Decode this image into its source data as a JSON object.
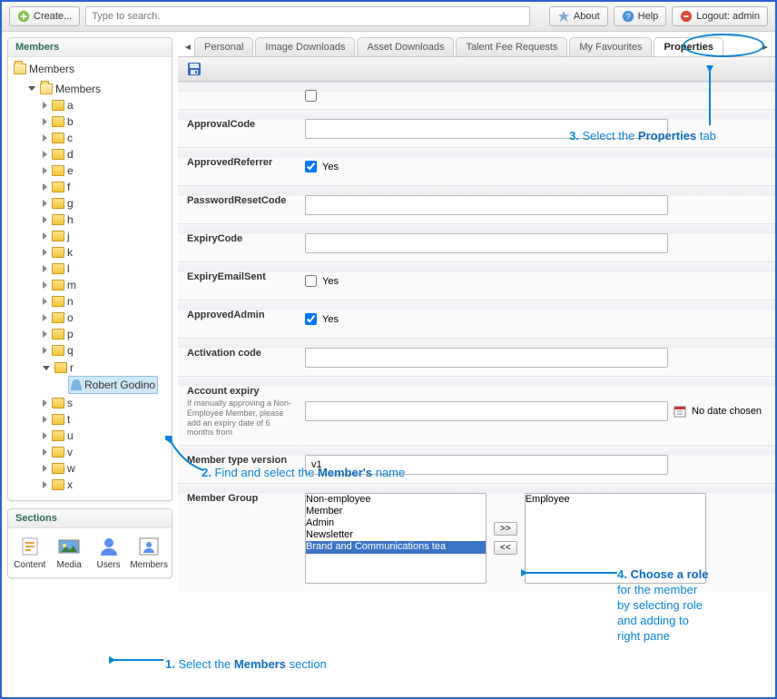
{
  "topbar": {
    "create_label": "Create...",
    "search_placeholder": "Type to search.",
    "about_label": "About",
    "help_label": "Help",
    "logout_label": "Logout: admin"
  },
  "left_panel": {
    "title": "Members",
    "root": "Members",
    "group": "Members",
    "letters": [
      "a",
      "b",
      "c",
      "d",
      "e",
      "f",
      "g",
      "h",
      "j",
      "k",
      "l",
      "m",
      "n",
      "o",
      "p",
      "q",
      "r",
      "s",
      "t",
      "u",
      "v",
      "w",
      "x"
    ],
    "expanded_letter": "r",
    "selected_member": "Robert Godino"
  },
  "sections": {
    "title": "Sections",
    "items": [
      {
        "label": "Content"
      },
      {
        "label": "Media"
      },
      {
        "label": "Users"
      },
      {
        "label": "Members"
      }
    ]
  },
  "tabs": {
    "items": [
      {
        "label": "Personal"
      },
      {
        "label": "Image Downloads"
      },
      {
        "label": "Asset Downloads"
      },
      {
        "label": "Talent Fee Requests"
      },
      {
        "label": "My Favourites"
      },
      {
        "label": "Properties",
        "active": true
      }
    ]
  },
  "form": {
    "approval_code": {
      "label": "ApprovalCode",
      "value": ""
    },
    "approved_referrer": {
      "label": "ApprovedReferrer",
      "checked": true,
      "yes": "Yes"
    },
    "password_reset_code": {
      "label": "PasswordResetCode",
      "value": ""
    },
    "expiry_code": {
      "label": "ExpiryCode",
      "value": ""
    },
    "expiry_email_sent": {
      "label": "ExpiryEmailSent",
      "checked": false,
      "yes": "Yes"
    },
    "approved_admin": {
      "label": "ApprovedAdmin",
      "checked": true,
      "yes": "Yes"
    },
    "activation_code": {
      "label": "Activation code",
      "value": ""
    },
    "account_expiry": {
      "label": "Account expiry",
      "hint": "If manually approving a Non-Employee Member, please add an expiry date of 6 months from",
      "value": "",
      "no_date": "No date chosen"
    },
    "member_type_version": {
      "label": "Member type version",
      "value": "v1"
    },
    "member_group": {
      "label": "Member Group",
      "available": [
        "Non-employee",
        "Member",
        "Admin",
        "Newsletter",
        "Brand and Communications tea"
      ],
      "available_selected": "Brand and Communications tea",
      "chosen": [
        "Employee"
      ],
      "add": ">>",
      "remove": "<<"
    }
  },
  "annotations": {
    "a1": {
      "num": "1.",
      "text": "Select the ",
      "bold": "Members",
      "suffix": " section"
    },
    "a2": {
      "num": "2.",
      "text": "Find and select the ",
      "bold": "Member's",
      "suffix": " name"
    },
    "a3": {
      "num": "3.",
      "text": "Select the ",
      "bold": "Properties",
      "suffix": " tab"
    },
    "a4": {
      "num": "4.",
      "lines": [
        "Choose a role",
        "for the member",
        "by selecting role",
        "and adding to",
        "right pane"
      ]
    }
  }
}
